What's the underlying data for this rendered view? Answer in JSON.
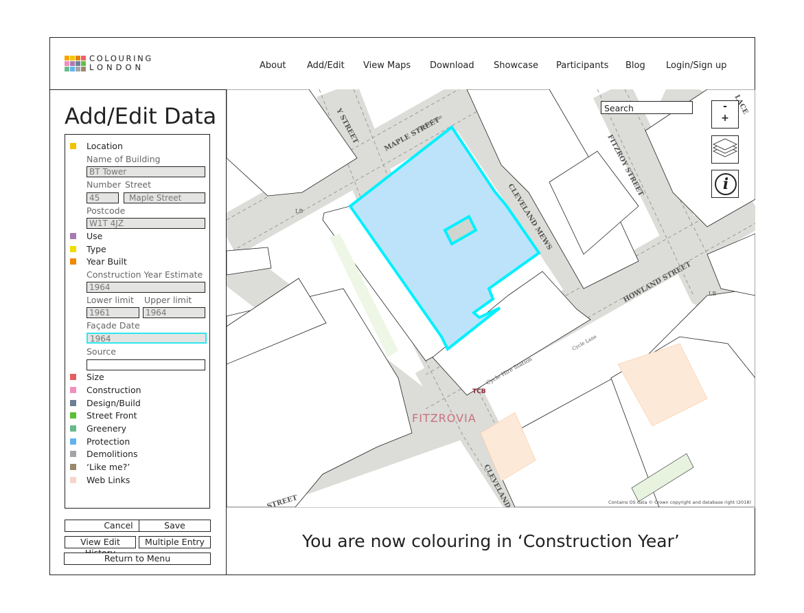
{
  "logo": {
    "line1": "COLOURING",
    "line2": "LONDON",
    "colors": [
      "#f7a600",
      "#f5c400",
      "#e4820f",
      "#ec6169",
      "#ef8fbe",
      "#a87eb0",
      "#6e8099",
      "#62c13f",
      "#6dbd8e",
      "#64b5f0",
      "#a6a6a9",
      "#9d8a6e"
    ]
  },
  "nav": [
    "About",
    "Add/Edit",
    "View Maps",
    "Download",
    "Showcase",
    "Participants",
    "Blog",
    "Login/Sign up"
  ],
  "sidebar": {
    "title": "Add/Edit Data",
    "categories": [
      {
        "label": "Location",
        "color": "#f2c200"
      },
      {
        "label": "Use",
        "color": "#a67bb0"
      },
      {
        "label": "Type",
        "color": "#f0dc00"
      },
      {
        "label": "Year Built",
        "color": "#f08a00"
      },
      {
        "label": "Size",
        "color": "#e35f62"
      },
      {
        "label": "Construction",
        "color": "#f08fc0"
      },
      {
        "label": "Design/Build",
        "color": "#6c7f97"
      },
      {
        "label": "Street Front",
        "color": "#5bbf33"
      },
      {
        "label": "Greenery",
        "color": "#67b98c"
      },
      {
        "label": "Protection",
        "color": "#63b2f0"
      },
      {
        "label": "Demolitions",
        "color": "#a3a3a8"
      },
      {
        "label": "‘Like me?’",
        "color": "#9b876b"
      },
      {
        "label": "Web Links",
        "color": "#f7d3c8"
      }
    ],
    "location_fields": {
      "name_label": "Name of Building",
      "name_value": "BT Tower",
      "number_label": "Number",
      "street_label": "Street",
      "number_value": "45",
      "street_value": "Maple Street",
      "postcode_label": "Postcode",
      "postcode_value": "W1T 4JZ"
    },
    "year_fields": {
      "estimate_label": "Construction Year Estimate",
      "estimate_value": "1964",
      "lower_label": "Lower limit",
      "upper_label": "Upper limit",
      "lower_value": "1961",
      "upper_value": "1964",
      "facade_label": "Façade Date",
      "facade_value": "1964",
      "source_label": "Source",
      "source_value": ""
    },
    "buttons": {
      "cancel": "Cancel",
      "save": "Save",
      "history": "View Edit History",
      "multiple": "Multiple Entry",
      "return": "Return to Menu"
    }
  },
  "map": {
    "search_placeholder": "Search",
    "zoom_out": "-",
    "zoom_in": "+",
    "info": "i",
    "highlight_color": "#bde3fb",
    "highlight_outline": "#00f0ff",
    "labels": {
      "maple": "MAPLE STREET",
      "cycle_lane": "Cycle Lane",
      "cleveland_mews": "CLEVELAND MEWS",
      "fitzroy": "FITZROY STREET",
      "howland": "HOWLAND STREET",
      "cycle_hire": "Cycle Hire Station",
      "tcb": "TCB",
      "fitzrovia": "FITZROVIA",
      "cleveland": "CLEVELAND",
      "street_top": "Y STREET",
      "street_bottom": "STREET",
      "lb": "LB",
      "place": "LACE"
    },
    "attribution": "Contains OS data © Crown copyright and database right (2018)"
  },
  "message": "You are now colouring in ‘Construction Year’"
}
